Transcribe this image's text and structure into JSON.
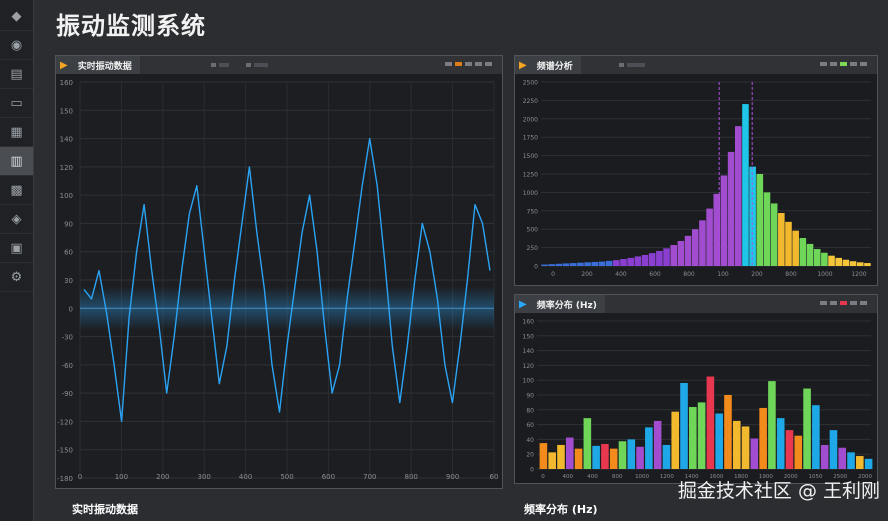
{
  "app": {
    "title": "振动监测系统",
    "watermark": "掘金技术社区 @ 王利刚"
  },
  "sidebar": {
    "icons": [
      "dashboard-icon",
      "gauge-icon",
      "database-icon",
      "monitor-icon",
      "chart-icon",
      "layers-icon",
      "sensor-icon",
      "gear-icon",
      "display-icon",
      "settings-icon"
    ],
    "active_index": 5
  },
  "panels": {
    "realtime": {
      "tab_label": "实时振动数据",
      "caption": "实时振动数据"
    },
    "spectrum": {
      "tab_label": "频谱分析"
    },
    "distribution": {
      "tab_label": "频率分布 (Hz)",
      "caption": "频率分布 (Hz)"
    }
  },
  "colors": {
    "accent_orange": "#f5a623",
    "accent_blue": "#2aa8ff",
    "signal": "#2ba3f5"
  },
  "chart_data": [
    {
      "id": "realtime",
      "type": "line",
      "x_ticks": [
        "0",
        "100",
        "200",
        "300",
        "400",
        "500",
        "600",
        "700",
        "800",
        "900",
        "60"
      ],
      "y_ticks": [
        "160",
        "150",
        "140",
        "120",
        "100",
        "90",
        "60",
        "30",
        "0",
        "-30",
        "-60",
        "-90",
        "-120",
        "-150",
        "-180"
      ],
      "xlim": [
        0,
        1000
      ],
      "grid": true,
      "series": [
        {
          "values": [
            20,
            10,
            40,
            -5,
            -60,
            -120,
            -10,
            60,
            110,
            40,
            -20,
            -90,
            -30,
            40,
            100,
            130,
            60,
            -10,
            -80,
            -40,
            30,
            90,
            150,
            80,
            20,
            -60,
            -110,
            -40,
            20,
            80,
            120,
            60,
            -20,
            -90,
            -60,
            10,
            70,
            130,
            180,
            130,
            50,
            -40,
            -100,
            -40,
            30,
            90,
            60,
            10,
            -60,
            -100,
            -40,
            30,
            110,
            90,
            40
          ]
        }
      ]
    },
    {
      "id": "spectrum",
      "type": "bar",
      "y_ticks": [
        "2500",
        "2250",
        "2000",
        "1750",
        "1500",
        "1250",
        "1000",
        "750",
        "500",
        "250",
        "0"
      ],
      "x_ticks": [
        "0",
        "200",
        "400",
        "600",
        "800",
        "100",
        "200",
        "800",
        "1000",
        "1200"
      ],
      "ylim": [
        0,
        2500
      ],
      "values": [
        20,
        25,
        30,
        35,
        40,
        45,
        50,
        55,
        60,
        70,
        80,
        95,
        110,
        130,
        150,
        175,
        205,
        240,
        285,
        340,
        410,
        500,
        620,
        780,
        980,
        1230,
        1550,
        1900,
        2200,
        1350,
        1250,
        1000,
        850,
        720,
        600,
        480,
        380,
        300,
        230,
        180,
        140,
        110,
        85,
        65,
        50,
        40
      ],
      "markers": [
        600,
        800
      ]
    },
    {
      "id": "distribution",
      "type": "bar",
      "y_ticks": [
        "160",
        "150",
        "140",
        "120",
        "100",
        "90",
        "80",
        "60",
        "40",
        "20",
        "0"
      ],
      "x_ticks": [
        "0",
        "400",
        "400",
        "800",
        "1000",
        "1200",
        "1400",
        "1600",
        "1800",
        "1900",
        "2000",
        "1050",
        "2500",
        "2000"
      ],
      "ylim": [
        0,
        160
      ],
      "values": [
        28,
        18,
        26,
        34,
        22,
        55,
        25,
        27,
        22,
        30,
        32,
        24,
        45,
        52,
        26,
        62,
        93,
        67,
        72,
        100,
        60,
        80,
        52,
        46,
        33,
        66,
        95,
        55,
        42,
        36,
        87,
        69,
        26,
        42,
        23,
        18,
        14,
        11
      ]
    }
  ]
}
